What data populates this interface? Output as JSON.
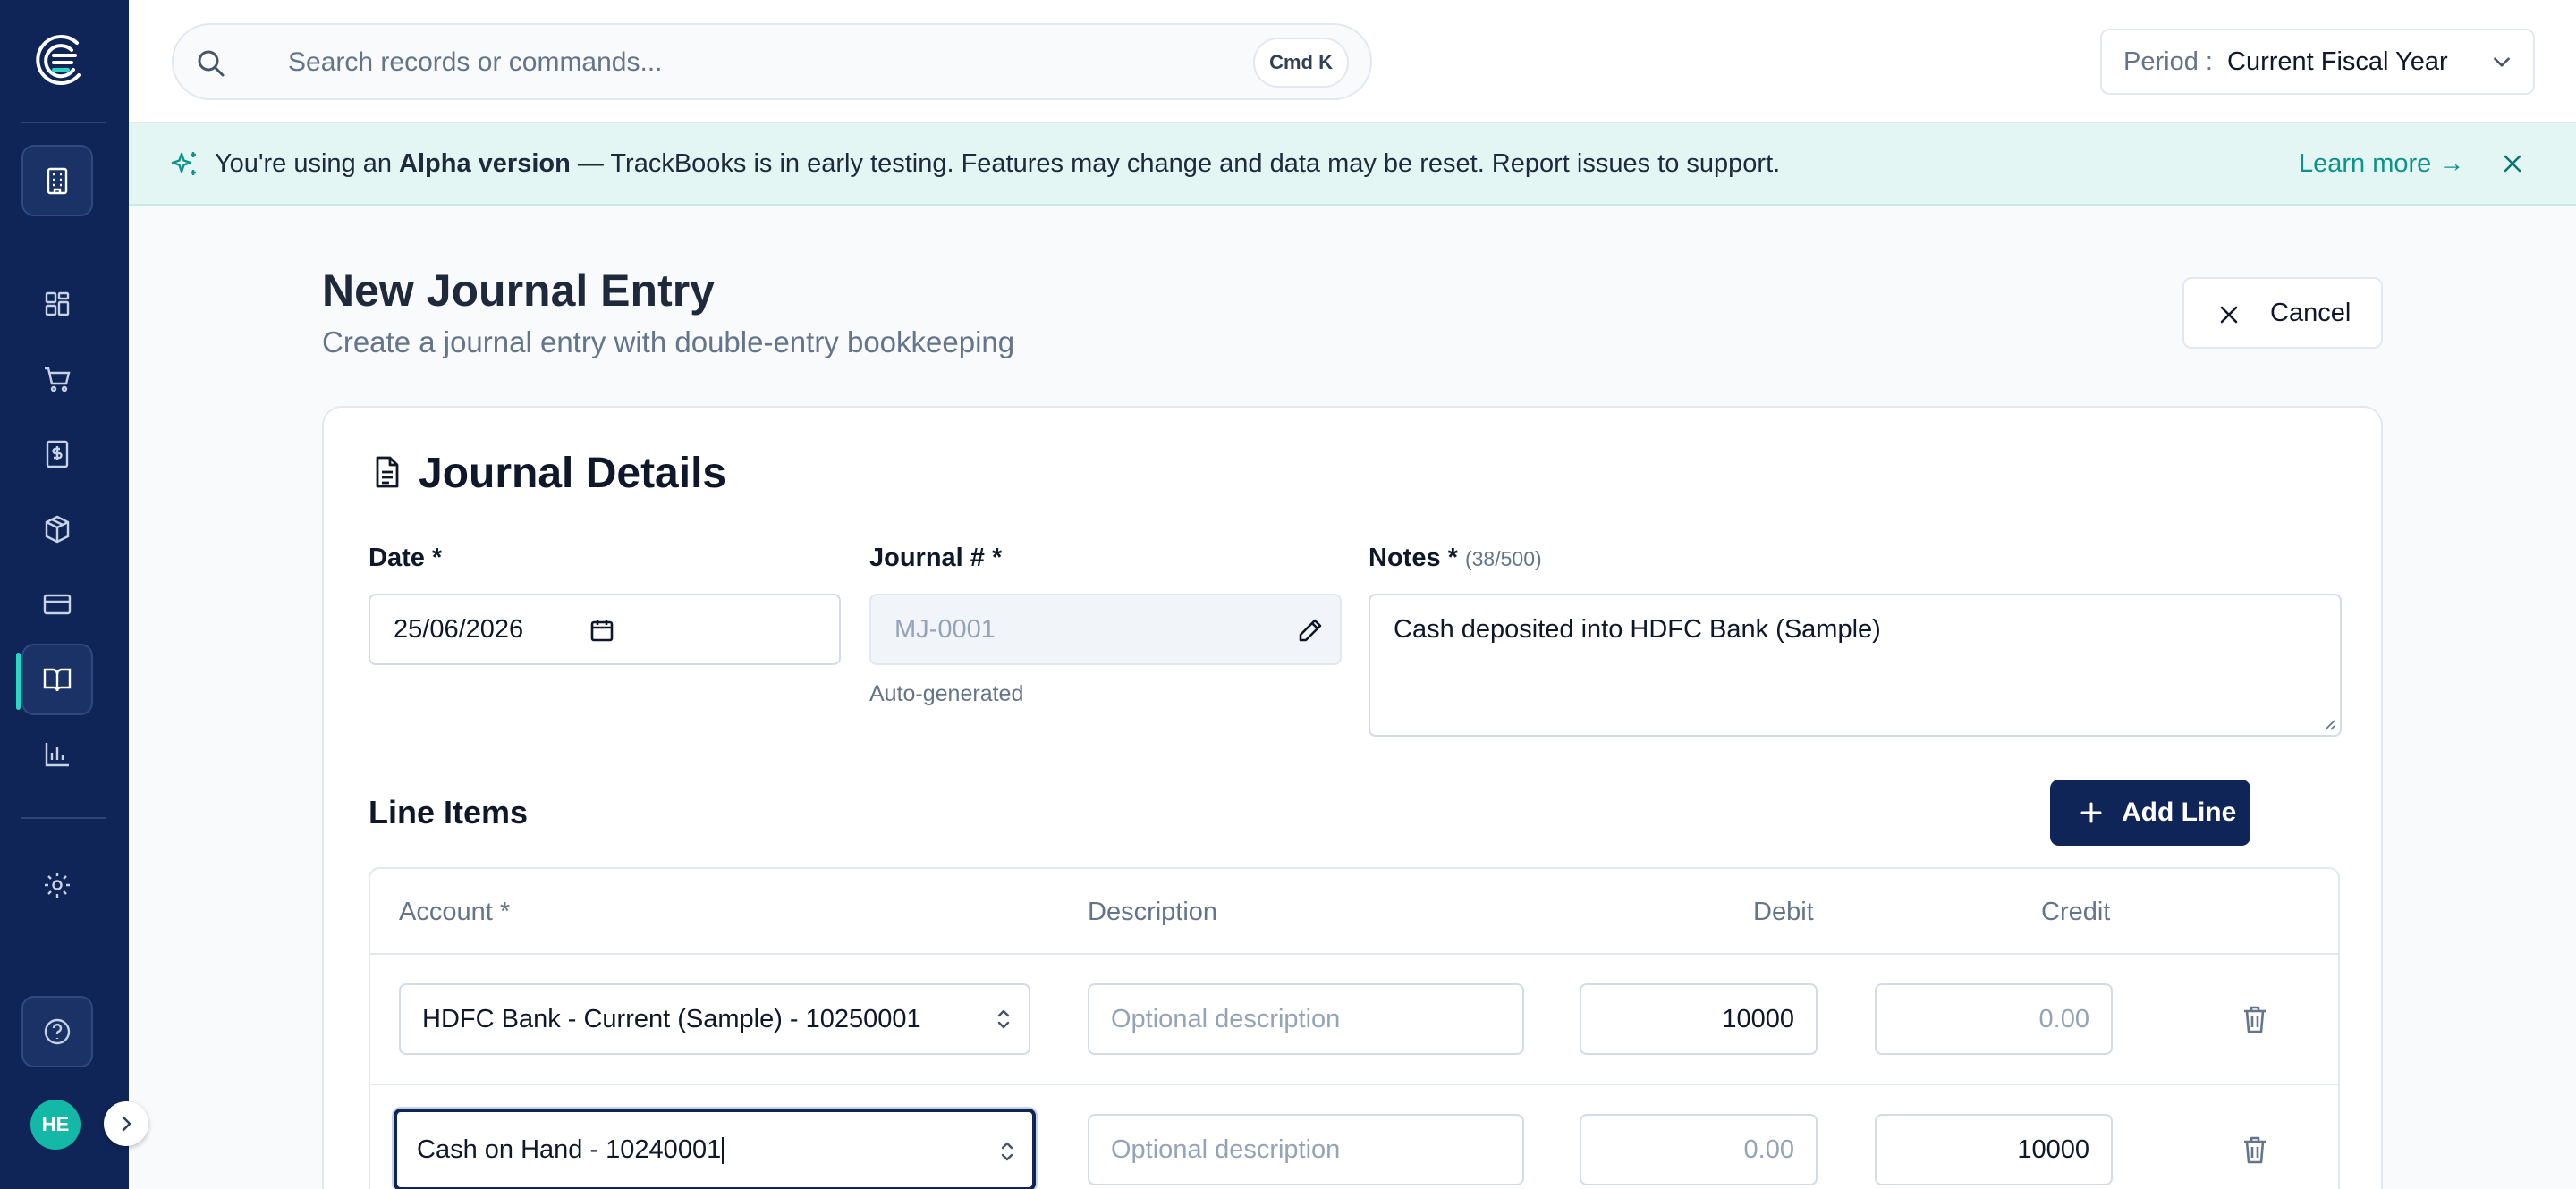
{
  "app": {
    "user_initials": "HE"
  },
  "search": {
    "placeholder": "Search records or commands...",
    "shortcut": "Cmd K"
  },
  "period": {
    "label": "Period :",
    "value": "Current Fiscal Year"
  },
  "banner": {
    "prefix": "You're using an ",
    "strong": "Alpha version",
    "suffix": " — TrackBooks is in early testing. Features may change and data may be reset. Report issues to support.",
    "link": "Learn more →"
  },
  "page": {
    "title": "New Journal Entry",
    "subtitle": "Create a journal entry with double-entry bookkeeping",
    "cancel_label": "Cancel"
  },
  "details": {
    "title": "Journal Details",
    "date_label": "Date *",
    "date_value": "25/06/2026",
    "journal_label": "Journal # *",
    "journal_value": "MJ-0001",
    "journal_help": "Auto-generated",
    "notes_label": "Notes *",
    "notes_count": "(38/500)",
    "notes_value": "Cash deposited into HDFC Bank (Sample)"
  },
  "line_items": {
    "title": "Line Items",
    "add_label": "Add Line",
    "columns": {
      "account": "Account *",
      "description": "Description",
      "debit": "Debit",
      "credit": "Credit"
    },
    "rows": [
      {
        "account": "HDFC Bank - Current (Sample) - 10250001",
        "description_placeholder": "Optional description",
        "debit": "10000",
        "credit_placeholder": "0.00"
      },
      {
        "account": "Cash on Hand - 10240001",
        "description_placeholder": "Optional description",
        "debit_placeholder": "0.00",
        "credit": "10000"
      }
    ]
  },
  "colors": {
    "sidebar": "#0f2557",
    "accent": "#14b8a6",
    "banner_bg": "#e3f6f3",
    "primary_button": "#0f2557"
  }
}
